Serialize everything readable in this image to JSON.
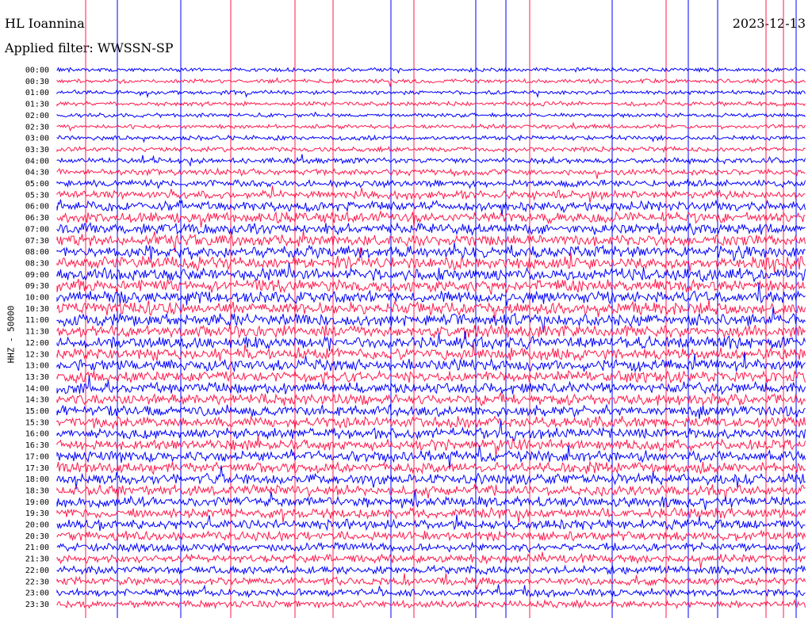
{
  "header": {
    "station": "HL Ioannina",
    "filter": "Applied filter: WWSSN-SP",
    "date": "2023-12-13"
  },
  "chart_data": {
    "type": "line",
    "title": "HL Ioannina",
    "subtitle": "Applied filter: WWSSN-SP",
    "date": "2023-12-13",
    "ylabel": "HHZ - 50000",
    "row_labels": [
      "00:00",
      "00:30",
      "01:00",
      "01:30",
      "02:00",
      "02:30",
      "03:00",
      "03:30",
      "04:00",
      "04:30",
      "05:00",
      "05:30",
      "06:00",
      "06:30",
      "07:00",
      "07:30",
      "08:00",
      "08:30",
      "09:00",
      "09:30",
      "10:00",
      "10:30",
      "11:00",
      "11:30",
      "12:00",
      "12:30",
      "13:00",
      "13:30",
      "14:00",
      "14:30",
      "15:00",
      "15:30",
      "16:00",
      "16:30",
      "17:00",
      "17:30",
      "18:00",
      "18:30",
      "19:00",
      "19:30",
      "20:00",
      "20:30",
      "21:00",
      "21:30",
      "22:00",
      "22:30",
      "23:00",
      "23:30"
    ],
    "colors": [
      "#0000ff",
      "#ff1a4d"
    ],
    "noise_level": [
      0.1,
      0.12,
      0.1,
      0.12,
      0.1,
      0.12,
      0.14,
      0.16,
      0.22,
      0.28,
      0.34,
      0.42,
      0.55,
      0.62,
      0.68,
      0.72,
      0.75,
      0.78,
      0.8,
      0.78,
      0.76,
      0.76,
      0.74,
      0.74,
      0.72,
      0.72,
      0.7,
      0.7,
      0.68,
      0.68,
      0.68,
      0.68,
      0.66,
      0.66,
      0.66,
      0.66,
      0.64,
      0.64,
      0.6,
      0.58,
      0.55,
      0.52,
      0.48,
      0.44,
      0.42,
      0.4,
      0.38,
      0.36
    ],
    "grid": false
  }
}
